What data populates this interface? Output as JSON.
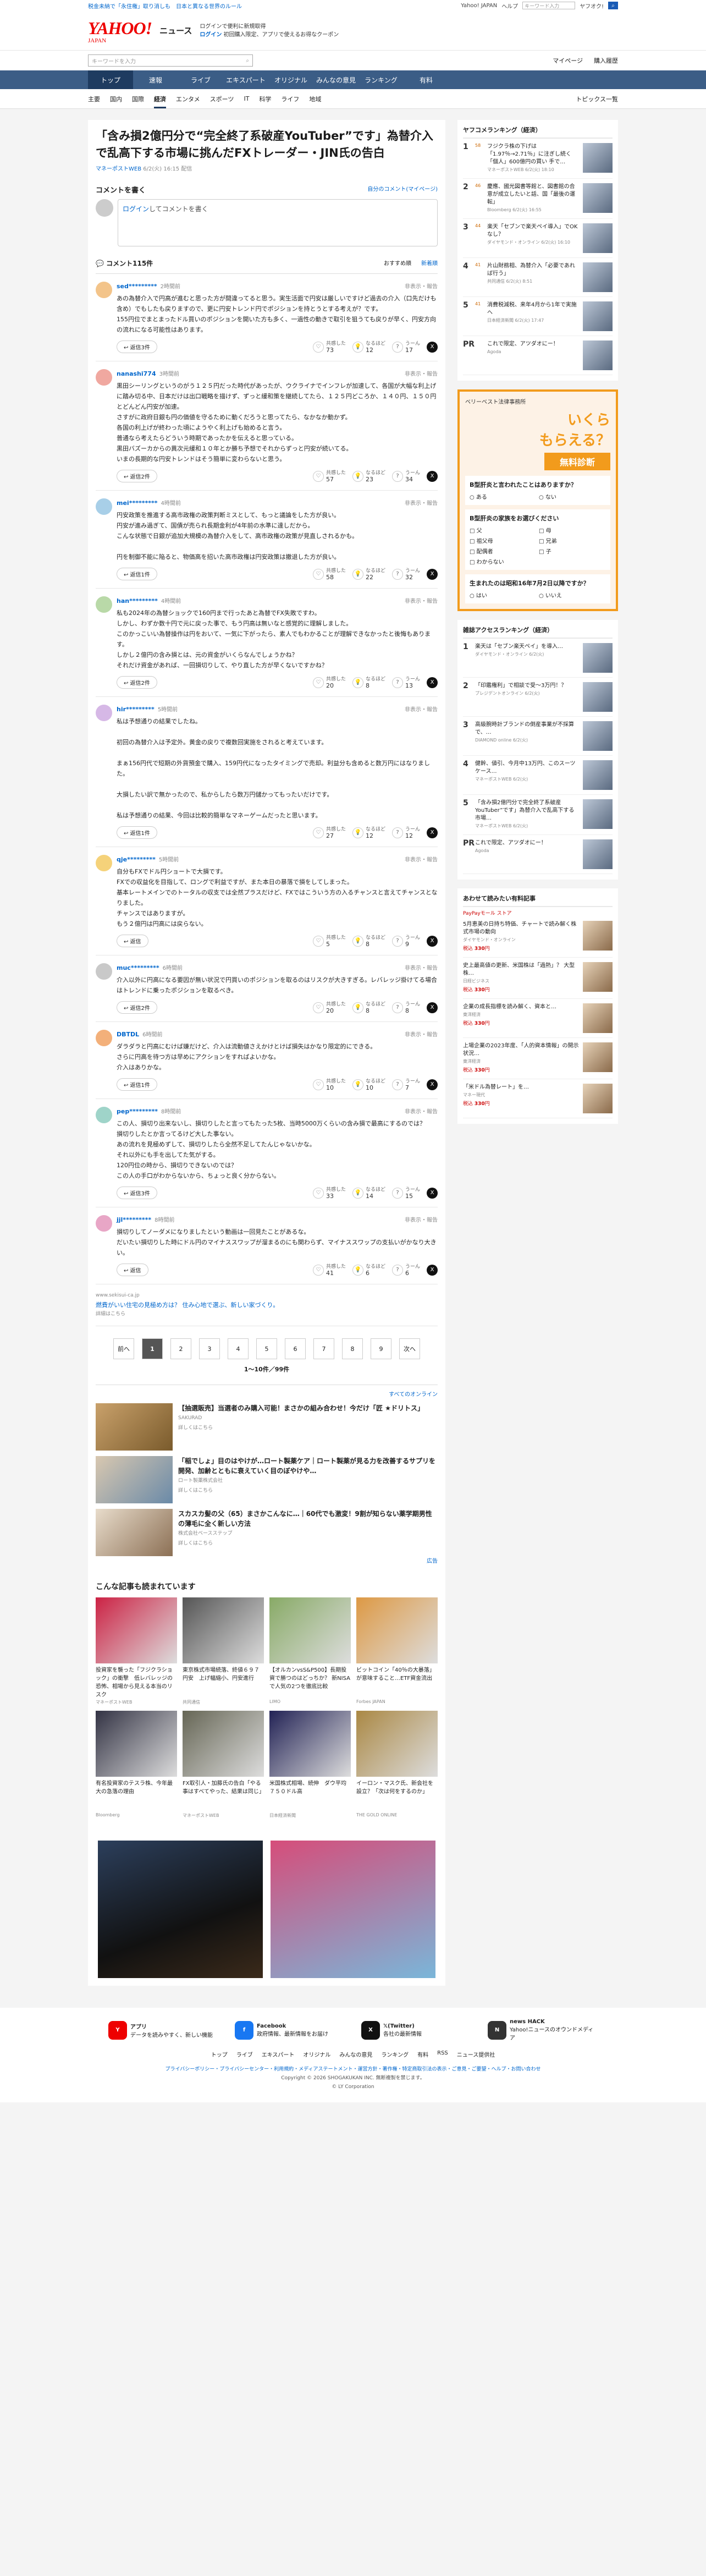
{
  "topbar": {
    "left": "税金未納で「永住権」取り消しも　日本と異なる世界のルール",
    "links": [
      "Yahoo! JAPAN",
      "ヘルプ"
    ],
    "search_placeholder": "キーワード入力",
    "search_mode": "ヤフオク!"
  },
  "header": {
    "logo": "YAHOO!",
    "logo_sub": "JAPAN",
    "service": "ニュース",
    "promo_line1": "ログインで便利に新規取得",
    "promo_line2": "ログイン",
    "promo_line3": "初回購入限定、アプリで使えるお得なクーポン"
  },
  "search": {
    "placeholder": "キーワードを入力",
    "links": [
      "マイページ",
      "購入履歴"
    ]
  },
  "gnav": [
    "トップ",
    "速報",
    "ライブ",
    "エキスパート",
    "オリジナル",
    "みんなの意見",
    "ランキング",
    "有料"
  ],
  "gnav_active": "トップ",
  "snav": [
    "主要",
    "国内",
    "国際",
    "経済",
    "エンタメ",
    "スポーツ",
    "IT",
    "科学",
    "ライフ",
    "地域"
  ],
  "snav_active": "経済",
  "snav_right": "トピックス一覧",
  "article": {
    "title": "「含み損2億円分で“完全終了系破産YouTuber”です」為替介入で乱高下する市場に挑んだFXトレーダー・JIN氏の告白",
    "source": "マネーポストWEB",
    "date": "6/2(火) 16:15 配信"
  },
  "comment_form": {
    "heading": "コメントを書く",
    "my_comments": "自分のコメント(マイページ)",
    "prompt_link": "ログイン",
    "prompt_rest": "してコメントを書く"
  },
  "comments_meta": {
    "count_label": "コメント115件",
    "sort_options": [
      "おすすめ順",
      "新着順"
    ]
  },
  "reaction_labels": [
    "共感した",
    "なるほど",
    "うーん"
  ],
  "reply_label": "返信",
  "report_label": "非表示・報告",
  "comments": [
    {
      "user": "sed*********",
      "time": "2時間前",
      "text": "あの為替介入で円高が進むと思った方が間違ってると思う。実生活面で円安は厳しいですけど過去の介入（口先だけも含め）でもしたも戻りますので、更に円安トレンド円でポジションを持とうとする考えが？です。\n155円位でまとまったドル買いのポジションを開いた方も多く、一過性の動きで取引を狙うても戻りが早く、円安方向の流れになる可能性はあります。",
      "replies": "返信3件",
      "reacts": [
        "73",
        "12",
        "17"
      ]
    },
    {
      "user": "nanashi774",
      "time": "3時間前",
      "text": "黒田シーリングというのがう１２５円だった時代があったが、ウクライナでインフレが加速して、各国が大幅な利上げに踏み切る中、日本だけは出口戦略を描けず、ずっと緩和策を継続してたら、１２５円どころか、１４０円、１５０円とどんどん円安が加速。\nさすがに政府日銀も円の価値を守るために動くだろうと思ってたら、なかなか動かず。\n各国の利上げが終わった頃にようやく利上げも始めると言う。\n普通なら考えたらどういう時期であったかを伝えると思っている。\n黒田バズーカからの異次元緩和１０年とか勝ち予想でそれからずっと円安が続いてる。\nいまの長期的な円安トレンドはそう簡単に変わらないと思う。",
      "replies": "返信2件",
      "reacts": [
        "57",
        "23",
        "34"
      ]
    },
    {
      "user": "mei*********",
      "time": "4時間前",
      "text": "円安政策を推進する高市政権の政策判断ミスとして、もっと議論をした方が良い。\n円安が進み過ぎて、国債が売られ長期金利が4年前の水準に達しだから。\nこんな状態で日銀が追加大規模の為替介入をして、高市政権の政策が見直しされるかも。\n\n円を制御不能に陥ると、物価高を招いた高市政権は円安政策は撤退した方が良い。",
      "replies": "返信1件",
      "reacts": [
        "58",
        "22",
        "32"
      ]
    },
    {
      "user": "han*********",
      "time": "4時間前",
      "text": "私も2024年の為替ショックで160円まで行ったあと為替でFX失敗ですわ。\nしかし、わずか数十円で元に戻った事で、もう円高は無いなと感覚的に理解しました。\nこのかっこいい為替操作は円をおいて、一気に下がったら、素人でもわかることが理解できなかったと後悔もあります。\nしかし２億円の含み損とは、元の資金がいくらなんでしょうかね？\nそれだけ資金があれば、一回損切りして、やり直した方が早くないですかね？",
      "replies": "返信2件",
      "reacts": [
        "20",
        "8",
        "13"
      ]
    },
    {
      "user": "hir*********",
      "time": "5時間前",
      "text": "私は予想通りの結果でしたね。\n\n初回の為替介入は予定外。黄金の戻りで複数回実施をされると考えています。\n\nまぁ156円代で短期の外貨預金で購入、159円代になったタイミングで売却。利益分も含めると数万円にはなりました。\n\n大損したい訳で無かったので、私からしたら数万円儲かってもったいだけです。\n\n私は予想通りの結果、今回は比較的簡単なマネーゲームだったと思います。",
      "replies": "返信1件",
      "reacts": [
        "27",
        "12",
        "12"
      ]
    },
    {
      "user": "qje*********",
      "time": "5時間前",
      "text": "自分もFXでドル円ショートで大損です。\nFXでの収益化を目指して、ロングで利益ですが、また本日の暴落で損をしてしまった。\n基本レートメインでのトータルの収支では全然プラスだけど、FXではこういう方の入るチャンスと言えてチャンスとなりました。\nチャンスではありますが。\nもう２億円は円高には戻らない。",
      "replies": "",
      "reacts": [
        "5",
        "8",
        "9"
      ]
    },
    {
      "user": "muc*********",
      "time": "6時間前",
      "text": "介入以外に円高になる要因が無い状況で円買いのポジションを取るのはリスクが大きすぎる。レバレッジ掛けてる場合はトレンドに乗ったポジションを取るべき。",
      "replies": "返信2件",
      "reacts": [
        "20",
        "8",
        "8"
      ]
    },
    {
      "user": "DBTDL",
      "time": "6時間前",
      "text": "ダラダラと円高にむけば嫌だけど、介入は流動値さえかけとけば損失はかなり限定的にできる。\nさらに円高を待つ方は早めにアクションをすればよいかな。\n介入はありかな。",
      "replies": "返信1件",
      "reacts": [
        "10",
        "10",
        "7"
      ]
    },
    {
      "user": "pep*********",
      "time": "8時間前",
      "text": "この人、損切り出来ないし、損切りしたと言ってもたった5枚、当時5000万くらいの含み損で最高にするのでは？\n損切りしたとか言ってるけど大した事ない。\nあの流れを見極めずして、損切りしたら全然不足してたんじゃないかな。\nそれ以外にも手を出してた気がする。\n120円位の時から、損切りできないのでは？\nこの人の手口がわからないから、ちょっと良く分からない。",
      "replies": "返信3件",
      "reacts": [
        "33",
        "14",
        "15"
      ]
    },
    {
      "user": "jjl*********",
      "time": "8時間前",
      "text": "損切りしてノーダメになりましたという動画は一回見たことがあるな。\nだいたい損切りした時にドル円のマイナススワップが溜まるのにも関わらず、マイナススワップの支払いがかなり大きい。",
      "replies": "",
      "reacts": [
        "41",
        "6",
        "6"
      ]
    }
  ],
  "inline_ad": {
    "src": "www.sekisui-ca.jp",
    "text": "燃費がいい住宅の見極め方は？ 住み心地で選ぶ、新しい家づくり。",
    "link": "詳細はこちら"
  },
  "pager": {
    "prev": "前へ",
    "next": "次へ",
    "pages": [
      "1",
      "2",
      "3",
      "4",
      "5",
      "6",
      "7",
      "8",
      "9"
    ],
    "current": "1",
    "count": "1〜10件／99件"
  },
  "ads": {
    "label": "広告",
    "more": "すべてのオンライン",
    "items": [
      {
        "title": "【抽選販売】当選者のみ購入可能！まさかの組み合わせ！今だけ「匠 ★ドリトス」",
        "src": "SAKURAD",
        "link": "詳しくはこちら"
      },
      {
        "title": "「稲でしょ」目のはやけが…ロート製薬ケア｜ロート製薬が見る力を改善するサプリを開発、加齢とともに衰えていく目のぼやけや…",
        "src": "ロート製薬株式会社",
        "link": "詳しくはこちら"
      },
      {
        "title": "スカスカ髪の父（65）まさかこんなに…｜60代でも激変！9割が知らない薬学期男性の薄毛に全く新しい方法",
        "src": "株式会社ベースステップ",
        "link": "詳しくはこちら"
      }
    ]
  },
  "recs": {
    "title": "こんな記事も読まれています",
    "items": [
      {
        "text": "投資家を襲った「フジクラショック」の衝撃　低レバレッジの恐怖、相場から見える本当のリスク",
        "src": "マネーポストWEB"
      },
      {
        "text": "東京株式市場続落、終値６９７円安　上げ幅縮小、円安進行",
        "src": "共同通信"
      },
      {
        "text": "【オルカンvsS&P500】長期投資で勝つのはどっちか？ 新NISAで人気の2つを徹底比較",
        "src": "LIMO"
      },
      {
        "text": "ビットコイン「40％の大暴落」が意味すること…ETF資金流出",
        "src": "Forbes JAPAN"
      },
      {
        "text": "有名投資家のテスラ株、今年最大の急落の理由",
        "src": "Bloomberg"
      },
      {
        "text": "FX取引人・加藤氏の告白「やる事はすべてやった、結果は同じ」",
        "src": "マネーポストWEB"
      },
      {
        "text": "米国株式相場、続伸　ダウ平均７５０ドル高",
        "src": "日本経済新聞"
      },
      {
        "text": "イーロン・マスク氏、新会社を設立？「次は何をするのか」",
        "src": "THE GOLD ONLINE"
      }
    ]
  },
  "side": {
    "rank_title": "ヤフコメランキング（経済）",
    "ranks": [
      {
        "n": "1",
        "cnt": "58",
        "t": "フジクラ株の下げは「1.97％→2.71％」に注ぎし続く「個人」600億円の買い 手で…",
        "src": "マネーポストWEB 6/2(火) 18:10"
      },
      {
        "n": "2",
        "cnt": "46",
        "t": "慶應、國光図書等館と、図書館の合意が成立したいと話、国「最後の運転」",
        "src": "Bloomberg 6/2(火) 16:55"
      },
      {
        "n": "3",
        "cnt": "44",
        "t": "楽天「セブンで楽天ペイ導入」でOKなし？",
        "src": "ダイヤモンド・オンライン 6/2(火) 16:10"
      },
      {
        "n": "4",
        "cnt": "41",
        "t": "片山財務相、為替介入「必要であれば行う」",
        "src": "共同通信 6/2(火) 8:51"
      },
      {
        "n": "5",
        "cnt": "41",
        "t": "消費税減税、来年4月から1年で実施へ",
        "src": "日本経済新聞 6/2(火) 17:47"
      },
      {
        "n": "PR",
        "cnt": "",
        "t": "これで限定、アツダオにー！",
        "src": "Agoda"
      }
    ],
    "quiz": {
      "head": "ベリーベスト法律事務所",
      "big1": "いくら",
      "big2": "もらえる？",
      "badge": "無料診断",
      "q1": "B型肝炎と言われたことはありますか？",
      "q1o": [
        "ある",
        "ない"
      ],
      "q2": "B型肝炎の家族をお選びください",
      "q2o": [
        "父",
        "母",
        "祖父母",
        "兄弟",
        "配偶者",
        "子",
        "わからない"
      ],
      "q3": "生まれたのは昭和16年7月2日以降ですか？",
      "q3o": [
        "はい",
        "いいえ"
      ]
    },
    "access_title": "雑誌アクセスランキング（経済）",
    "access": [
      {
        "n": "1",
        "t": "楽天は「セブン楽天ペイ」を導入…",
        "src": "ダイヤモンド・オンライン 6/2(火)"
      },
      {
        "n": "2",
        "t": "「印鑑権利」で相談で受～3万円！？",
        "src": "プレジデントオンライン 6/2(火)"
      },
      {
        "n": "3",
        "t": "高級腕時計ブランドの倒産事業が不採算で、…",
        "src": "DIAMOND online 6/2(火)"
      },
      {
        "n": "4",
        "t": "健幹、値引、今月中13万円、このスーツケース…",
        "src": "マネーポストWEB 6/2(火)"
      },
      {
        "n": "5",
        "t": "「含み損2億円分で完全終了系破産YouTuber”です」為替介入で乱高下する市場…",
        "src": "マネーポストWEB 6/2(火)"
      },
      {
        "n": "PR",
        "t": "これで限定、アツダオにー！",
        "src": "Agoda"
      }
    ],
    "shop_title": "あわせて読みたい有料記事",
    "shop_sub": "PayPayモール ストア",
    "shops": [
      {
        "t": "5月恵美の日持ち特価、チャートで読み解く株式市場の動向",
        "src": "ダイヤモンド・オンライン",
        "price": "330"
      },
      {
        "t": "史上最高値の更新、米国株は「過熱」？ 大型株…",
        "src": "日経ビジネス",
        "price": "330"
      },
      {
        "t": "企業の成長指標を読み解く、資本と…",
        "src": "東洋経済",
        "price": "330"
      },
      {
        "t": "上場企業の2023年度、「人的資本情報」の開示状況…",
        "src": "東洋経済",
        "price": "330"
      },
      {
        "t": "「米ドル為替レート」を…",
        "src": "マネー現代",
        "price": "330"
      }
    ]
  },
  "footer": {
    "items": [
      {
        "title": "アプリ",
        "desc": "データを読みやすく、新しい機能"
      },
      {
        "title": "Facebook",
        "desc": "政府情報、最新情報をお届け"
      },
      {
        "title": "𝕏(Twitter)",
        "desc": "各社の最新情報"
      },
      {
        "title": "news HACK",
        "desc": "Yahoo!ニュースのオウンドメディア"
      }
    ],
    "nav": [
      "トップ",
      "ライブ",
      "エキスパート",
      "オリジナル",
      "みんなの意見",
      "ランキング",
      "有料",
      "RSS",
      "ニュース提供社"
    ],
    "links": "プライバシーポリシー・プライバシーセンター・利用規約・メディアステートメント・運営方針・著作権・特定商取引法の表示・ご意見・ご要望・ヘルプ・お問い合わせ",
    "copyright": "Copyright © 2026 SHOGAKUKAN INC. 無断複製を禁じます。",
    "copyright2": "© LY Corporation"
  }
}
